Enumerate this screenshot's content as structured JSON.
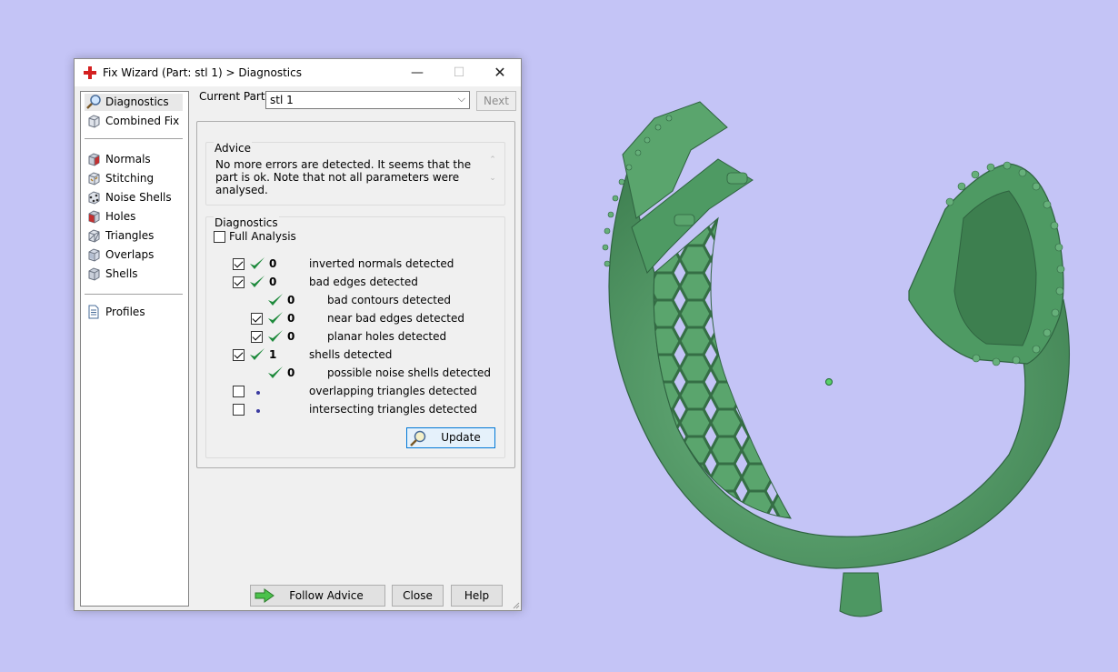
{
  "window": {
    "title": "Fix Wizard (Part: stl 1) > Diagnostics",
    "min_glyph": "—",
    "max_glyph": "☐",
    "close_glyph": "✕"
  },
  "sidebar": {
    "items": [
      {
        "label": "Diagnostics",
        "icon": "magnifier-icon",
        "selected": true
      },
      {
        "label": "Combined Fix",
        "icon": "cube-icon"
      },
      {
        "label": "Normals",
        "icon": "normals-cube-icon"
      },
      {
        "label": "Stitching",
        "icon": "stitching-cube-icon"
      },
      {
        "label": "Noise Shells",
        "icon": "noise-shells-icon"
      },
      {
        "label": "Holes",
        "icon": "holes-cube-icon"
      },
      {
        "label": "Triangles",
        "icon": "triangles-cube-icon"
      },
      {
        "label": "Overlaps",
        "icon": "overlaps-cube-icon"
      },
      {
        "label": "Shells",
        "icon": "shells-cube-icon"
      },
      {
        "label": "Profiles",
        "icon": "document-icon"
      }
    ]
  },
  "current_part": {
    "label": "Current Part:",
    "value": "stl 1",
    "next_label": "Next"
  },
  "advice": {
    "title": "Advice",
    "text": "No more errors are detected. It seems that the part is ok. Note that not all parameters were analysed."
  },
  "diagnostics": {
    "title": "Diagnostics",
    "full_analysis_label": "Full Analysis",
    "full_analysis_checked": false,
    "rows": [
      {
        "checked": true,
        "status": "ok",
        "count": "0",
        "label": "inverted normals detected"
      },
      {
        "checked": true,
        "status": "ok",
        "count": "0",
        "label": "bad edges detected"
      },
      {
        "status": "ok",
        "count": "0",
        "label": "bad contours detected"
      },
      {
        "checked": true,
        "status": "ok",
        "count": "0",
        "label": "near bad edges detected"
      },
      {
        "checked": true,
        "status": "ok",
        "count": "0",
        "label": "planar holes detected"
      },
      {
        "checked": true,
        "status": "ok",
        "count": "1",
        "label": "shells detected"
      },
      {
        "status": "ok",
        "count": "0",
        "label": "possible noise shells detected"
      },
      {
        "checked": false,
        "status": "not-analysed",
        "count": "",
        "label": "overlapping triangles detected"
      },
      {
        "checked": false,
        "status": "not-analysed",
        "count": "",
        "label": "intersecting triangles detected"
      }
    ],
    "update_label": "Update"
  },
  "footer": {
    "follow_advice_label": "Follow Advice",
    "close_label": "Close",
    "help_label": "Help"
  },
  "colors": {
    "viewport_bg": "#c4c4f6",
    "model_green": "#4e9a63",
    "tick_green": "#1e8a3c"
  }
}
